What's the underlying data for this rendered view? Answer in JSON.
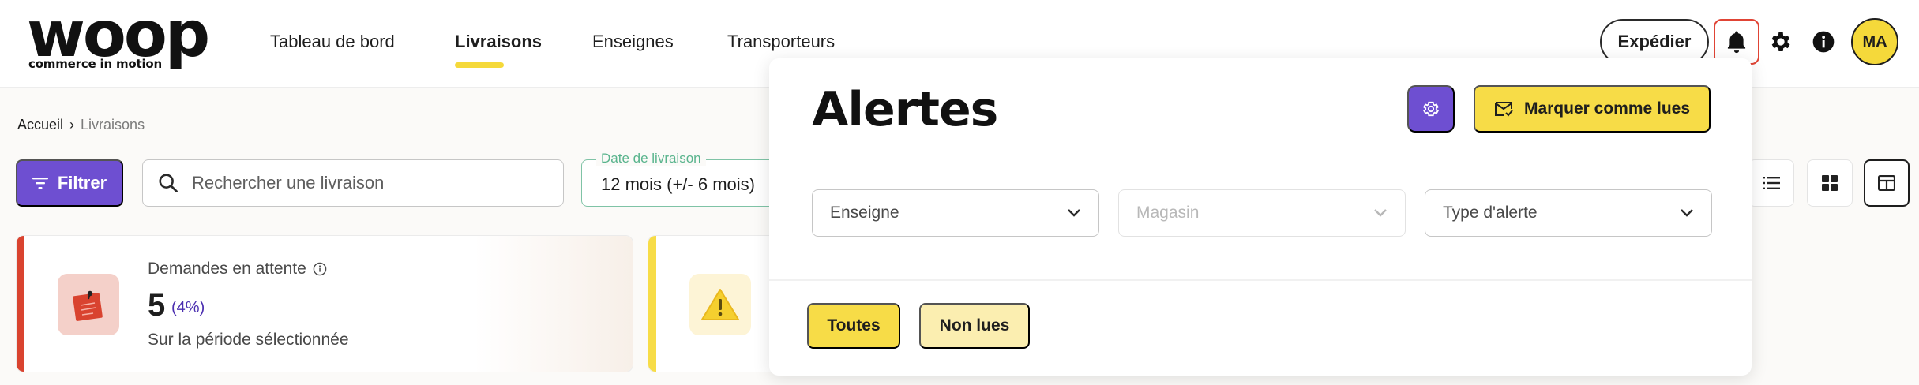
{
  "brand": {
    "logo_word": "woop",
    "logo_tagline": "commerce in motion"
  },
  "nav": {
    "items": [
      {
        "label": "Tableau de bord"
      },
      {
        "label": "Livraisons"
      },
      {
        "label": "Enseignes"
      },
      {
        "label": "Transporteurs"
      }
    ],
    "active_item": "Livraisons"
  },
  "header": {
    "ship_button_label": "Expédier",
    "user_initials": "MA",
    "icons": [
      "bell-icon",
      "gear-icon",
      "info-icon"
    ]
  },
  "breadcrumb": {
    "home": "Accueil",
    "separator": "›",
    "current": "Livraisons"
  },
  "toolbar": {
    "filter_label": "Filtrer",
    "search_placeholder": "Rechercher une livraison",
    "date_label": "Date de livraison",
    "date_value": "12 mois (+/- 6 mois)",
    "view_icons": [
      "list-view-icon",
      "grid-view-icon",
      "table-view-icon"
    ],
    "active_view": "table-view-icon"
  },
  "cards": [
    {
      "title": "Demandes en attente",
      "value": "5",
      "percent": "(4%)",
      "subtitle": "Sur la période sélectionnée",
      "accent_color": "#d9432f",
      "icon": "sticky-note-icon"
    },
    {
      "accent_color": "#f7dc47",
      "icon": "warning-icon"
    }
  ],
  "alerts_panel": {
    "title": "Alertes",
    "settings_icon": "gear-icon",
    "mark_read_label": "Marquer comme lues",
    "filters": [
      {
        "placeholder": "Enseigne",
        "disabled": false
      },
      {
        "placeholder": "Magasin",
        "disabled": true
      },
      {
        "placeholder": "Type d'alerte",
        "disabled": false
      }
    ],
    "tabs": [
      {
        "label": "Toutes",
        "selected": true
      },
      {
        "label": "Non lues",
        "selected": false
      }
    ]
  },
  "colors": {
    "brand_purple": "#6e4fd1",
    "brand_yellow": "#f7dc47",
    "alert_red": "#e04435",
    "date_green": "#59b48d"
  }
}
